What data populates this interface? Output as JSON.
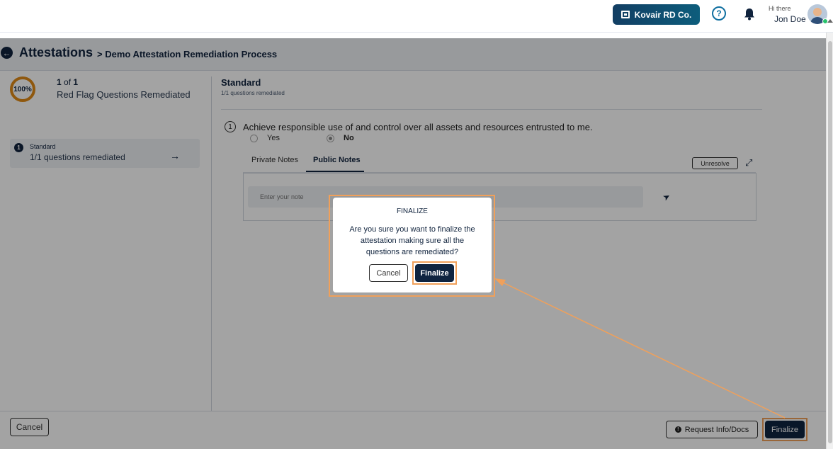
{
  "topbar": {
    "company": "Kovair RD Co.",
    "greeting": "Hi there",
    "user_name": "Jon Doe"
  },
  "header": {
    "title": "Attestations",
    "breadcrumb": "> Demo Attestation Remediation Process"
  },
  "progress": {
    "percent_label": "100%",
    "current": "1",
    "of_text": "of",
    "total": "1",
    "label": "Red Flag Questions Remediated"
  },
  "steps": [
    {
      "number": "1",
      "title": "Standard",
      "subtitle": "1/1 questions remediated"
    }
  ],
  "section": {
    "title": "Standard",
    "subtitle": "1/1 questions remediated"
  },
  "question": {
    "number": "1",
    "text": "Achieve responsible use of and control over all assets and resources entrusted to me.",
    "options": [
      "Yes",
      "No"
    ],
    "selected": "No"
  },
  "notes": {
    "tabs": [
      "Private Notes",
      "Public Notes"
    ],
    "active_tab": "Public Notes",
    "unresolve_label": "Unresolve",
    "placeholder": "Enter your note"
  },
  "footer": {
    "cancel_label": "Cancel",
    "request_label": "Request Info/Docs",
    "finalize_label": "Finalize"
  },
  "dialog": {
    "title": "FINALIZE",
    "message": "Are you sure you want to finalize the attestation making sure all the questions are remediated?",
    "cancel_label": "Cancel",
    "finalize_label": "Finalize"
  },
  "colors": {
    "brand_navy": "#0f2440",
    "accent_orange": "#e08a17",
    "highlight_orange": "#f0a05a"
  }
}
